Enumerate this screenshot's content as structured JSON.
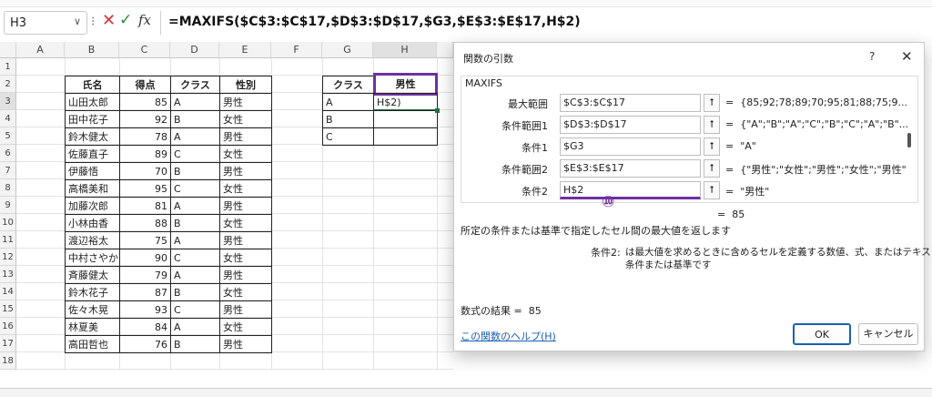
{
  "formula_bar": {
    "name_box": "H3",
    "sep": "⁝",
    "cancel": "✕",
    "enter": "✓",
    "fx": "fx",
    "formula": "=MAXIFS($C$3:$C$17,$D$3:$D$17,$G3,$E$3:$E$17,H$2)"
  },
  "columns": [
    "A",
    "B",
    "C",
    "D",
    "E",
    "F",
    "G",
    "H"
  ],
  "rows": [
    "1",
    "2",
    "3",
    "4",
    "5",
    "6",
    "7",
    "8",
    "9",
    "10",
    "11",
    "12",
    "13",
    "14",
    "15",
    "16",
    "17",
    "18"
  ],
  "table": {
    "headers": [
      "氏名",
      "得点",
      "クラス",
      "性別"
    ],
    "rows": [
      [
        "山田太郎",
        "85",
        "A",
        "男性"
      ],
      [
        "田中花子",
        "92",
        "B",
        "女性"
      ],
      [
        "鈴木健太",
        "78",
        "A",
        "男性"
      ],
      [
        "佐藤直子",
        "89",
        "C",
        "女性"
      ],
      [
        "伊藤悟",
        "70",
        "B",
        "男性"
      ],
      [
        "高橋美和",
        "95",
        "C",
        "女性"
      ],
      [
        "加藤次郎",
        "81",
        "A",
        "男性"
      ],
      [
        "小林由香",
        "88",
        "B",
        "女性"
      ],
      [
        "渡辺裕太",
        "75",
        "A",
        "男性"
      ],
      [
        "中村さやか",
        "90",
        "C",
        "女性"
      ],
      [
        "斉藤健太",
        "79",
        "A",
        "男性"
      ],
      [
        "鈴木花子",
        "87",
        "B",
        "女性"
      ],
      [
        "佐々木晃",
        "93",
        "C",
        "男性"
      ],
      [
        "林夏美",
        "84",
        "A",
        "女性"
      ],
      [
        "高田哲也",
        "76",
        "B",
        "男性"
      ]
    ]
  },
  "summary": {
    "header_class": "クラス",
    "header_gender": "男性",
    "classes": [
      "A",
      "B",
      "C"
    ],
    "edit_cell": "H$2)"
  },
  "dialog": {
    "title": "関数の引数",
    "help": "?",
    "close": "✕",
    "function_name": "MAXIFS",
    "args": [
      {
        "label": "最大範囲",
        "value": "$C$3:$C$17",
        "result": "{85;92;78;89;70;95;81;88;75;9..."
      },
      {
        "label": "条件範囲1",
        "value": "$D$3:$D$17",
        "result": "{\"A\";\"B\";\"A\";\"C\";\"B\";\"C\";\"A\";\"B\"..."
      },
      {
        "label": "条件1",
        "value": "$G3",
        "result": "\"A\""
      },
      {
        "label": "条件範囲2",
        "value": "$E$3:$E$17",
        "result": "{\"男性\";\"女性\";\"男性\";\"女性\";\"男性\""
      },
      {
        "label": "条件2",
        "value": "H$2",
        "result": "\"男性\""
      }
    ],
    "arrow": "⭡",
    "eq": "=",
    "overall_result": "85",
    "annotation": "⑩",
    "description": "所定の条件または基準で指定したセル間の最大値を返します",
    "arg_help_label": "条件2:",
    "arg_help_line1": "は最大値を求めるときに含めるセルを定義する数値、式、またはテキストの形式の",
    "arg_help_line2": "条件または基準です",
    "formula_result_label": "数式の結果 =",
    "formula_result": "85",
    "help_link": "この関数のヘルプ(H)",
    "ok": "OK",
    "cancel": "キャンセル"
  },
  "colors": {
    "accent": "#7030a0",
    "link": "#1a5fb4",
    "cancel_red": "#d13438",
    "enter_green": "#2b8a3e"
  }
}
